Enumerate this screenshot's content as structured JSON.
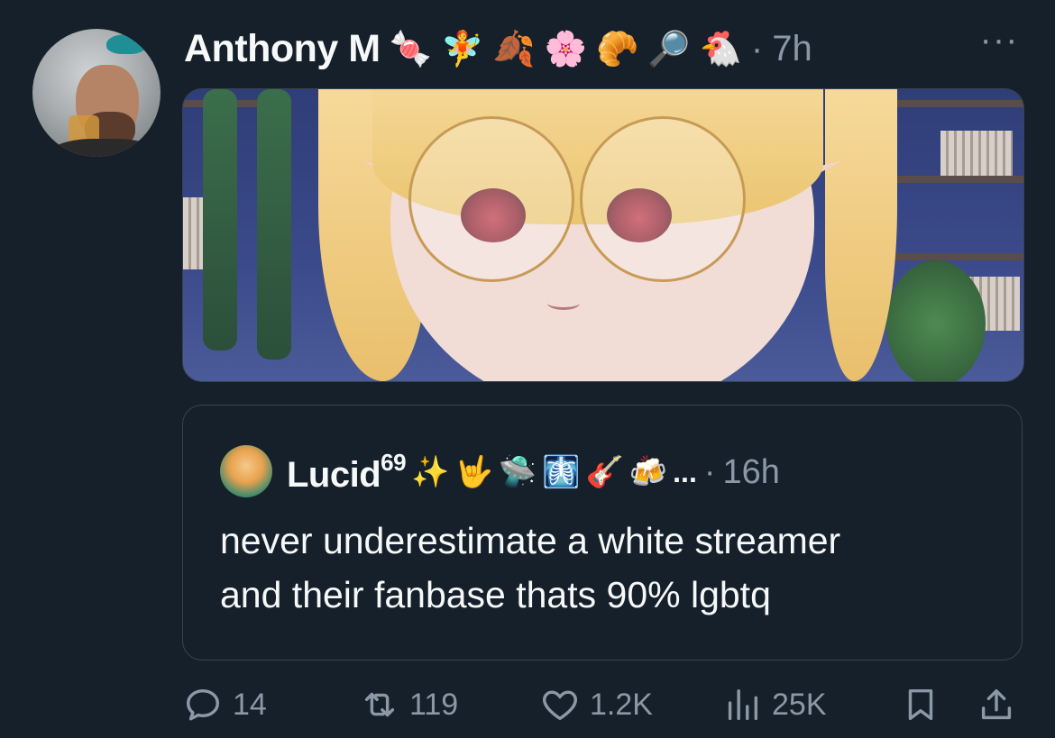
{
  "tweet": {
    "author_name": "Anthony M",
    "author_emojis": [
      "🍬",
      "🧚",
      "🍂",
      "🌸",
      "🥐",
      "🔎",
      "🐔"
    ],
    "separator": "·",
    "time": "7h",
    "more_label": "···"
  },
  "quote": {
    "author_name": "Lucid",
    "author_superscript": "69",
    "author_emojis": [
      "✨",
      "🤟",
      "🛸",
      "🩻",
      "🎸",
      "🍻"
    ],
    "ellipsis": "...",
    "separator": "·",
    "time": "16h",
    "text_line1": "never underestimate a white streamer",
    "text_line2": "and their fanbase thats 90% lgbtq"
  },
  "actions": {
    "replies": "14",
    "retweets": "119",
    "likes": "1.2K",
    "views": "25K"
  },
  "colors": {
    "background": "#15202b",
    "text": "#f7f9f9",
    "muted": "#8b98a5",
    "border": "#38444d"
  }
}
